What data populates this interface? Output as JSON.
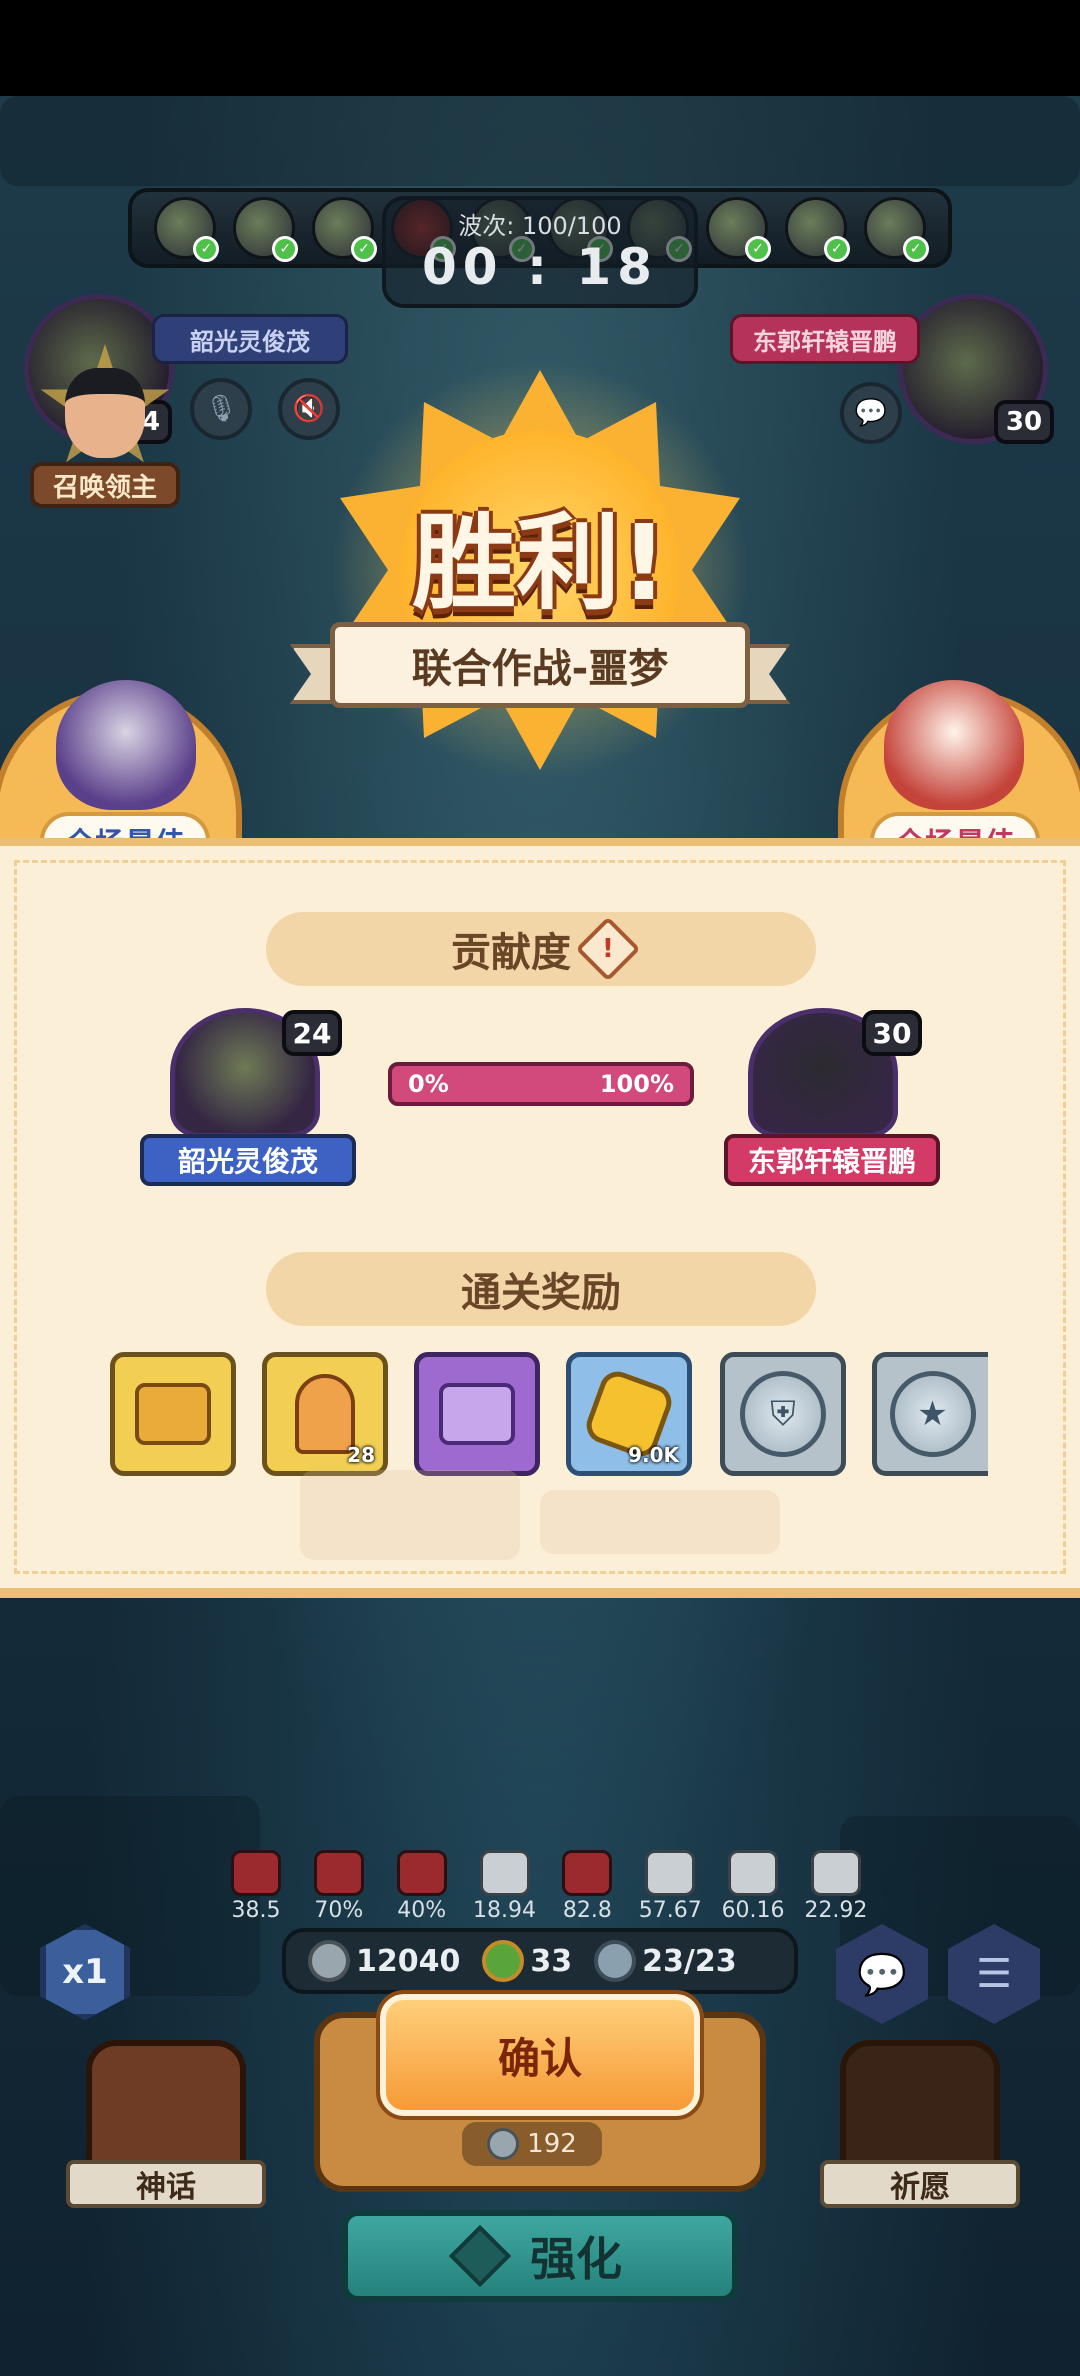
{
  "battle": {
    "wave_label": "波次: 100/100",
    "timer": "00 : 18"
  },
  "players": {
    "left": {
      "name": "韶光灵俊茂",
      "level": "24"
    },
    "right": {
      "name": "东郭轩辕晋鹏",
      "level": "30"
    }
  },
  "summon_lord_label": "召唤领主",
  "victory": {
    "title": "胜利!",
    "subtitle": "联合作战-噩梦"
  },
  "mvp": {
    "left_label": "全场最佳",
    "right_label": "全场最佳"
  },
  "contribution": {
    "title": "贡献度",
    "info_icon": "!",
    "bar_left": "0%",
    "bar_right": "100%",
    "fill_fraction": 1.0
  },
  "rewards": {
    "title": "通关奖励",
    "items": [
      {
        "icon": "gold-chest-icon",
        "qty": ""
      },
      {
        "icon": "orange-key-icon",
        "qty": "28"
      },
      {
        "icon": "purple-chest-icon",
        "qty": ""
      },
      {
        "icon": "gold-coin-icon",
        "qty": "9.0K"
      },
      {
        "icon": "shield-medal-icon",
        "qty": ""
      },
      {
        "icon": "star-medal-icon",
        "qty": ""
      }
    ]
  },
  "stats": [
    "38.5",
    "70%",
    "40%",
    "18.94",
    "82.8",
    "57.67",
    "60.16",
    "22.92"
  ],
  "resources": {
    "silver": "12040",
    "clover": "33",
    "units": "23/23"
  },
  "speed_label": "x1",
  "confirm_label": "确认",
  "confirm_cost": "192",
  "myth_label": "神话",
  "wish_label": "祈愿",
  "upgrade_label": "强化",
  "colors": {
    "panel_bg": "#fcefd8",
    "confirm": "#f59a37",
    "upgrade": "#3fa7a0",
    "left_name_plate": "#3d62c4",
    "right_name_plate": "#d33a66"
  }
}
